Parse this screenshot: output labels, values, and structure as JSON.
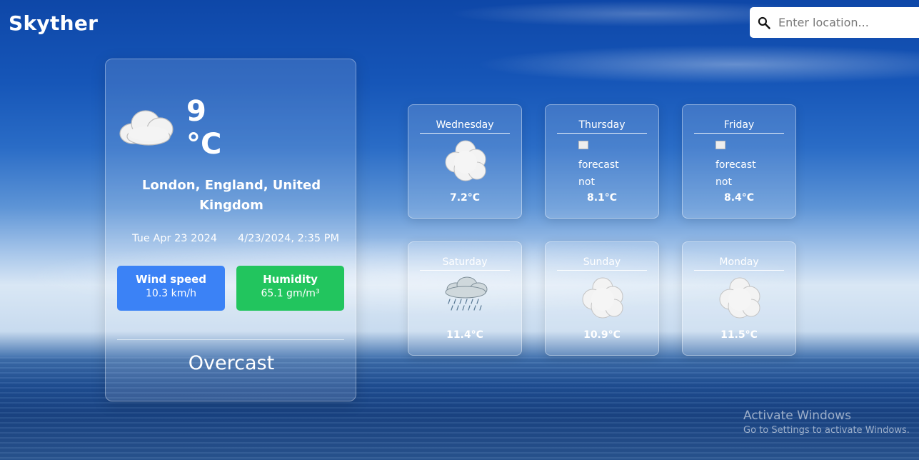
{
  "app": {
    "brand": "Skyther"
  },
  "search": {
    "placeholder": "Enter location..."
  },
  "current": {
    "icon": "overcast-cloud-icon",
    "temp_value": "9",
    "temp_unit": "°C",
    "location": "London, England, United Kingdom",
    "date": "Tue Apr 23 2024",
    "datetime": "4/23/2024, 2:35 PM",
    "wind": {
      "title": "Wind speed",
      "value": "10.3 km/h"
    },
    "humidity": {
      "title": "Humidity",
      "value": "65.1 gm/m³"
    },
    "condition": "Overcast"
  },
  "forecast": [
    {
      "day": "Wednesday",
      "temp": "7.2°C",
      "icon": "cloudy-icon",
      "broken": false
    },
    {
      "day": "Thursday",
      "temp": "8.1°C",
      "icon": "broken-image-icon",
      "broken": true,
      "alt_line1": "forecast",
      "alt_line2": "not"
    },
    {
      "day": "Friday",
      "temp": "8.4°C",
      "icon": "broken-image-icon",
      "broken": true,
      "alt_line1": "forecast",
      "alt_line2": "not"
    },
    {
      "day": "Saturday",
      "temp": "11.4°C",
      "icon": "rain-cloud-icon",
      "broken": false
    },
    {
      "day": "Sunday",
      "temp": "10.9°C",
      "icon": "cloudy-icon",
      "broken": false
    },
    {
      "day": "Monday",
      "temp": "11.5°C",
      "icon": "cloudy-icon",
      "broken": false
    }
  ],
  "watermark": {
    "line1": "Activate Windows",
    "line2": "Go to Settings to activate Windows."
  },
  "colors": {
    "wind_card": "#3b82f6",
    "humidity_card": "#22c55e"
  }
}
